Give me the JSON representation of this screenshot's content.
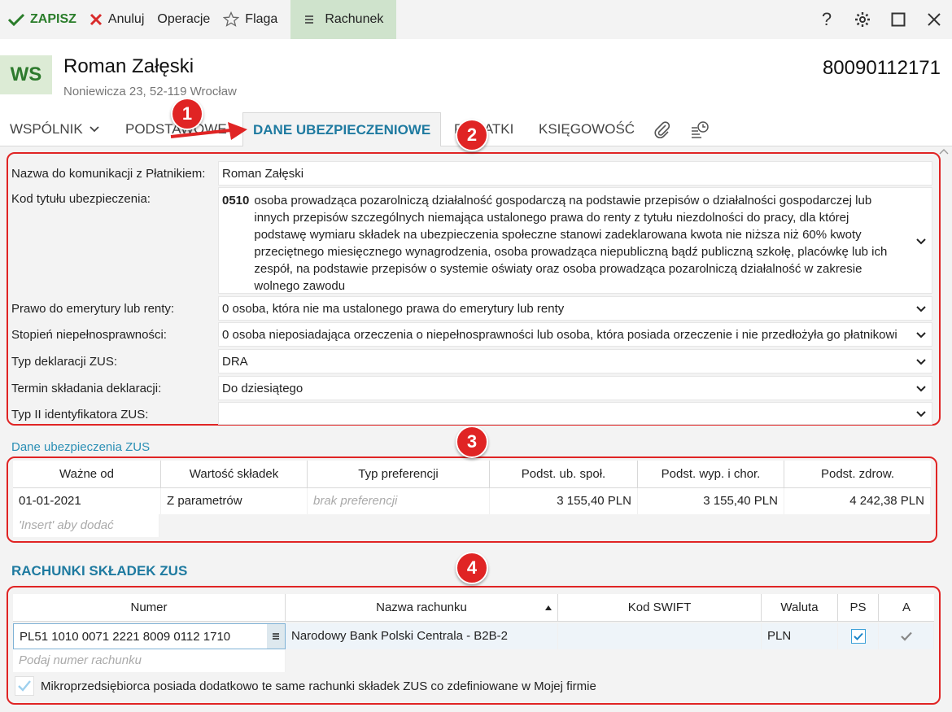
{
  "toolbar": {
    "save": "ZAPISZ",
    "cancel": "Anuluj",
    "operations": "Operacje",
    "flag": "Flaga",
    "account": "Rachunek",
    "help": "?"
  },
  "header": {
    "badge": "WS",
    "name": "Roman Załęski",
    "address": "Noniewicza 23, 52-119 Wrocław",
    "pesel": "80090112171"
  },
  "tabs": {
    "partner": "WSPÓLNIK",
    "basic": "PODSTAWOWE",
    "insurance": "DANE UBEZPIECZENIOWE",
    "taxes": "PODATKI",
    "accounting": "KSIĘGOWOŚĆ"
  },
  "annotations": [
    "1",
    "2",
    "3",
    "4"
  ],
  "form": {
    "comm_name_label": "Nazwa do komunikacji z Płatnikiem:",
    "comm_name_value": "Roman Załęski",
    "title_code_label": "Kod tytułu ubezpieczenia:",
    "title_code": "0510",
    "title_desc": "osoba prowadząca pozarolniczą działalność gospodarczą na podstawie przepisów o działalności gospodarczej lub innych przepisów szczególnych niemająca ustalonego prawa do renty z tytułu niezdolności do pracy, dla której podstawę wymiaru składek na ubezpieczenia społeczne stanowi zadeklarowana kwota nie niższa niż 60% kwoty przeciętnego miesięcznego wynagrodzenia, osoba prowadząca niepubliczną bądź publiczną szkołę, placówkę lub ich zespół, na podstawie przepisów o systemie oświaty oraz osoba prowadząca pozarolniczą działalność w zakresie wolnego zawodu",
    "pension_label": "Prawo do emerytury lub renty:",
    "pension_value": "0  osoba, która nie ma ustalonego prawa do emerytury lub renty",
    "disability_label": "Stopień niepełnosprawności:",
    "disability_value": "0  osoba nieposiadająca orzeczenia o niepełnosprawności lub osoba, która posiada orzeczenie i nie przedłożyła go płatnikowi",
    "decl_type_label": "Typ deklaracji ZUS:",
    "decl_type_value": "DRA",
    "deadline_label": "Termin składania deklaracji:",
    "deadline_value": "Do dziesiątego",
    "id2_label": "Typ II identyfikatora ZUS:",
    "id2_value": ""
  },
  "insurance_section": {
    "link": "Dane ubezpieczenia ZUS",
    "columns": [
      "Ważne od",
      "Wartość składek",
      "Typ preferencji",
      "Podst. ub. społ.",
      "Podst. wyp. i chor.",
      "Podst. zdrow."
    ],
    "rows": [
      [
        "01-01-2021",
        "Z parametrów",
        "brak preferencji",
        "3 155,40 PLN",
        "3 155,40 PLN",
        "4 242,38 PLN"
      ]
    ],
    "insert_hint": "'Insert' aby dodać"
  },
  "accounts_section": {
    "title": "RACHUNKI SKŁADEK ZUS",
    "columns": [
      "Numer",
      "Nazwa rachunku",
      "Kod SWIFT",
      "Waluta",
      "PS",
      "A"
    ],
    "rows": [
      [
        "PL51 1010 0071 2221 8009 0112 1710",
        "Narodowy Bank Polski Centrala - B2B-2",
        "",
        "PLN"
      ]
    ],
    "add_hint": "Podaj numer rachunku",
    "micro_label": "Mikroprzedsiębiorca posiada dodatkowo te same rachunki składek ZUS co zdefiniowane w Mojej firmie"
  }
}
